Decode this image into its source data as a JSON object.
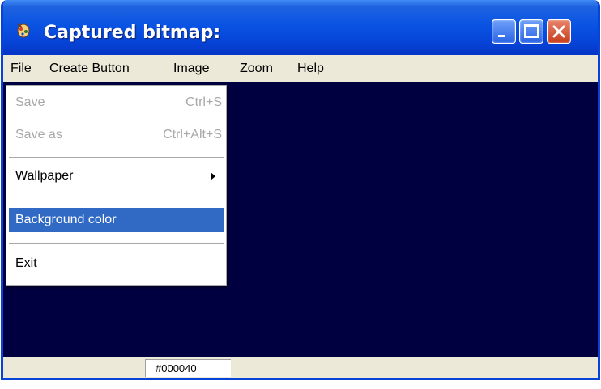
{
  "window": {
    "title": "Captured bitmap:"
  },
  "menubar": {
    "items": [
      {
        "label": "File"
      },
      {
        "label": "Create Button"
      },
      {
        "label": "Image"
      },
      {
        "label": "Zoom"
      },
      {
        "label": "Help"
      }
    ]
  },
  "file_menu": {
    "items": [
      {
        "label": "Save",
        "shortcut": "Ctrl+S",
        "enabled": false
      },
      {
        "label": "Save as",
        "shortcut": "Ctrl+Alt+S",
        "enabled": false
      },
      {
        "label": "Wallpaper",
        "has_submenu": true
      },
      {
        "label": "Background color",
        "selected": true
      },
      {
        "label": "Exit"
      }
    ]
  },
  "canvas": {
    "background_color": "#000040"
  },
  "statusbar": {
    "color_value": "#000040"
  },
  "colors": {
    "title_blue": "#0a54e3",
    "selection": "#316ac5",
    "chrome": "#ece9d8"
  },
  "icons": {
    "app": "app-icon",
    "minimize": "minimize-icon",
    "maximize": "maximize-icon",
    "close": "close-icon",
    "submenu": "submenu-arrow-icon"
  }
}
